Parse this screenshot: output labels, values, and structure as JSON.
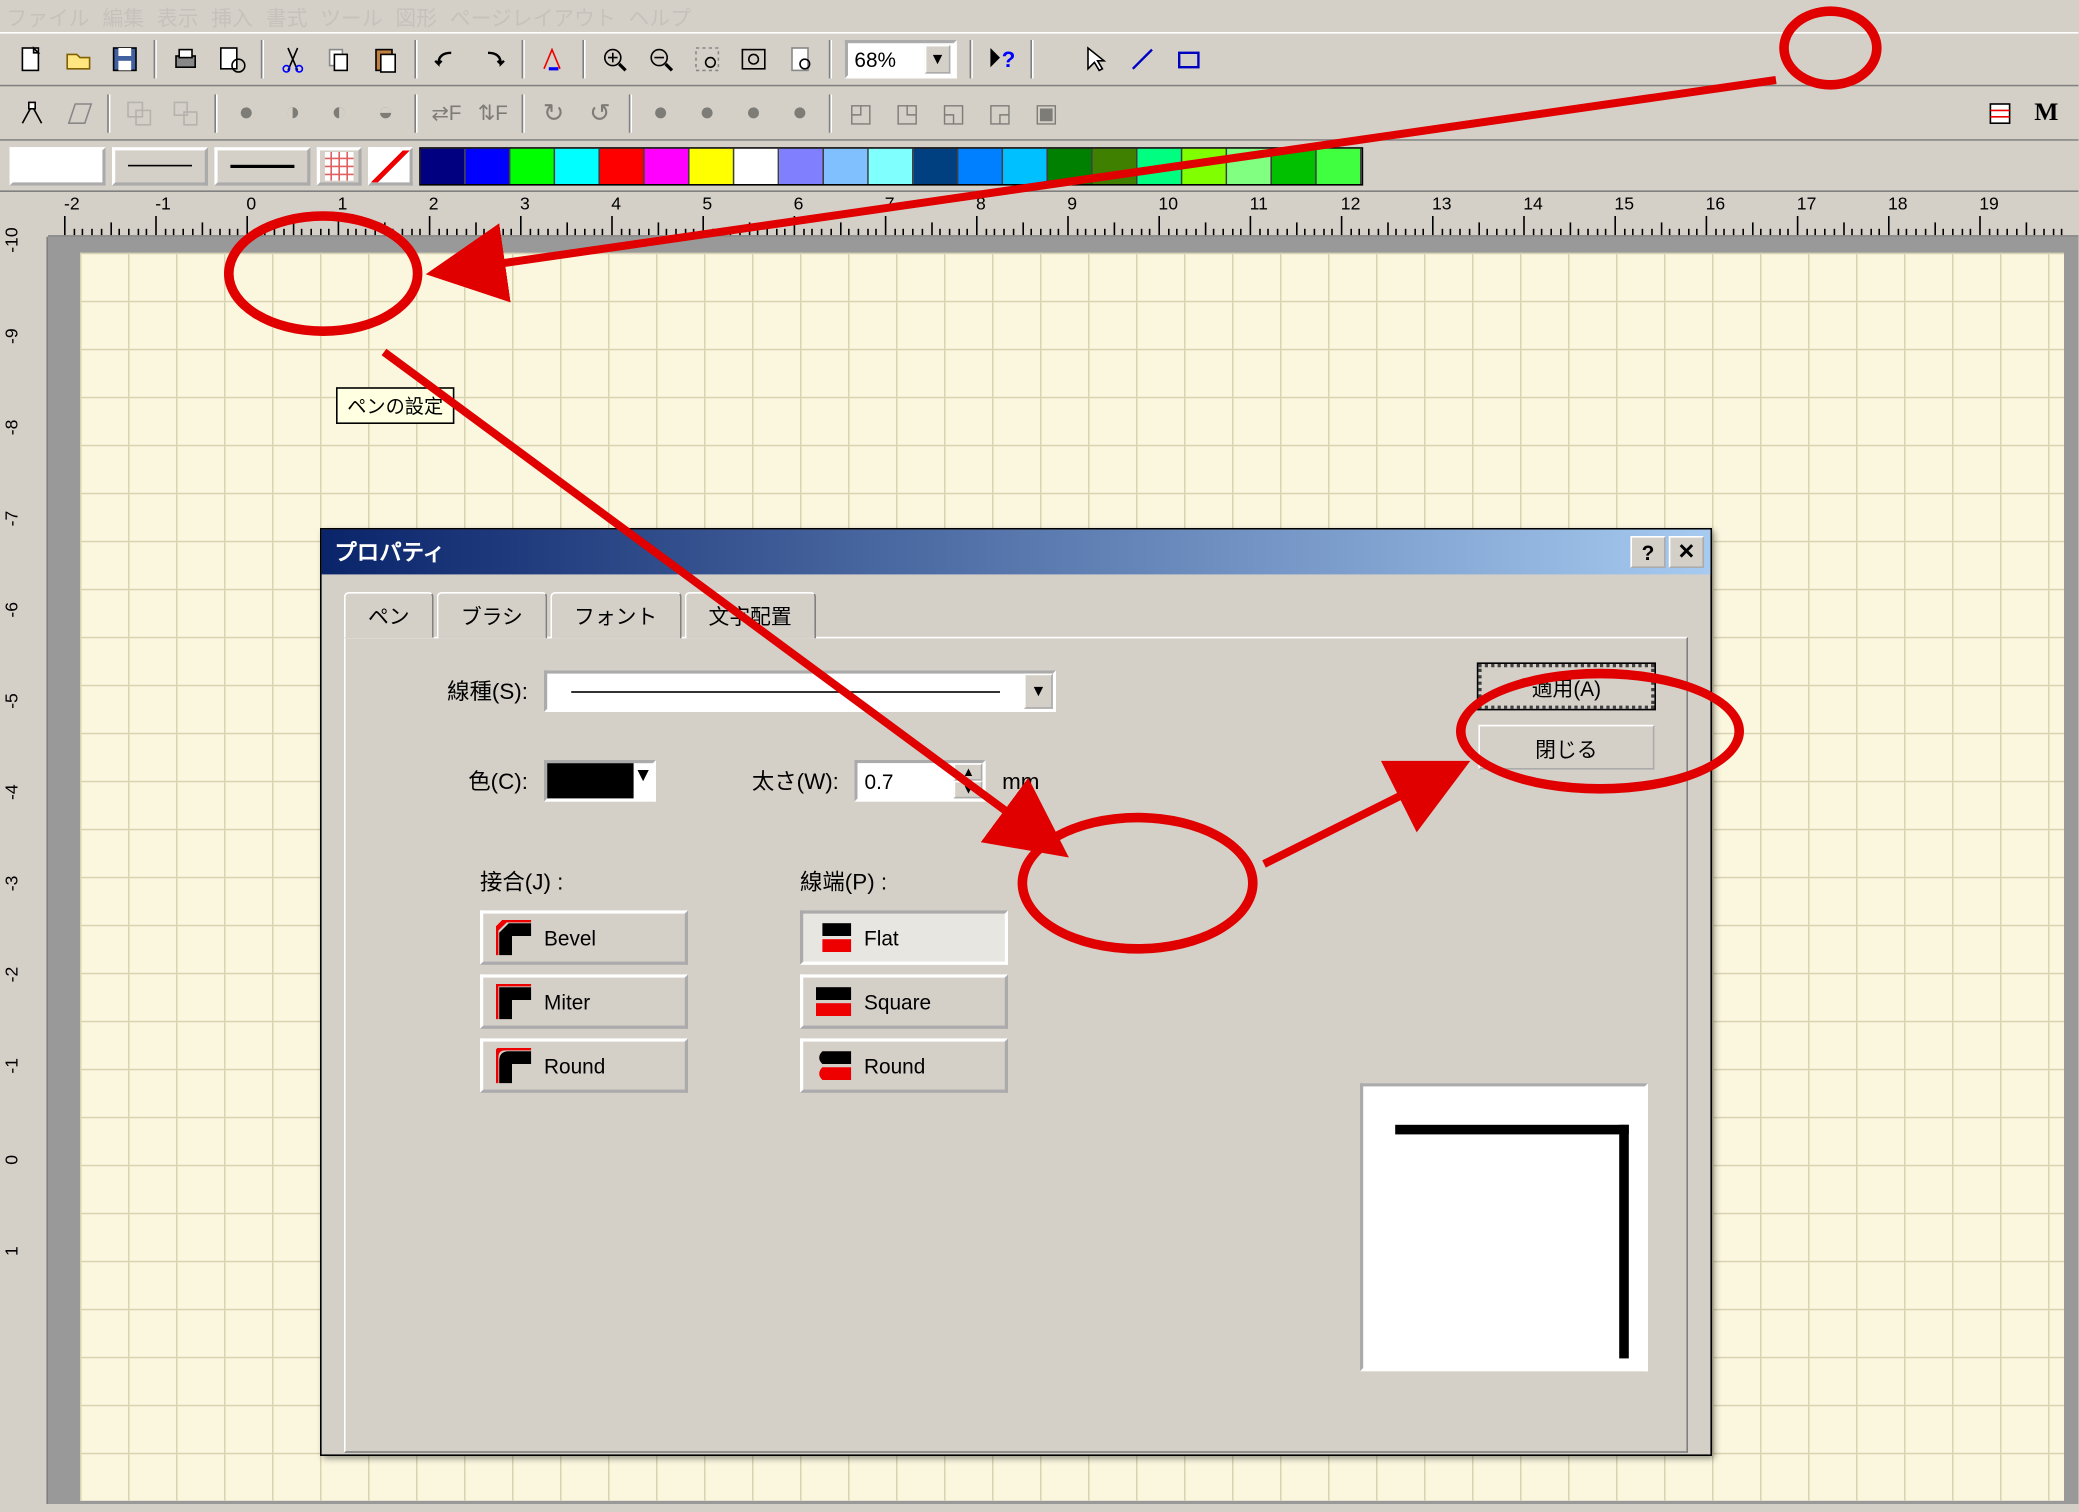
{
  "menubar": [
    "ファイル",
    "編集",
    "表示",
    "挿入",
    "書式",
    "ツール",
    "図形",
    "ページレイアウト",
    "ヘルプ"
  ],
  "toolbar": {
    "zoom": "68%"
  },
  "tooltip": "ペンの設定",
  "palette": [
    "#000080",
    "#0000ff",
    "#00ff00",
    "#00ffff",
    "#ff0000",
    "#ff00ff",
    "#ffff00",
    "#ffffff",
    "#8080ff",
    "#80c0ff",
    "#80ffff",
    "#004080",
    "#0080ff",
    "#00c0ff",
    "#008000",
    "#408000",
    "#00ff80",
    "#80ff00",
    "#80ff80",
    "#00c000",
    "#40ff40"
  ],
  "ruler_h": [
    -2,
    -1,
    0,
    1,
    2,
    3,
    4,
    5,
    6,
    7,
    8,
    9,
    10,
    11,
    12,
    13,
    14,
    15,
    16,
    17,
    18,
    19
  ],
  "ruler_v": [
    -10,
    -9,
    -8,
    -7,
    -6,
    -5,
    -4,
    -3,
    -2,
    -1,
    0,
    1
  ],
  "dialog": {
    "title": "プロパティ",
    "tabs": [
      "ペン",
      "ブラシ",
      "フォント",
      "文字配置"
    ],
    "labels": {
      "line_type": "線種(S):",
      "color": "色(C):",
      "width": "太さ(W):",
      "join": "接合(J) :",
      "cap": "線端(P) :"
    },
    "width_value": "0.7",
    "width_unit": "mm",
    "buttons": {
      "apply": "適用(A)",
      "close": "閉じる"
    },
    "join_options": [
      "Bevel",
      "Miter",
      "Round"
    ],
    "cap_options": [
      "Flat",
      "Square",
      "Round"
    ]
  }
}
